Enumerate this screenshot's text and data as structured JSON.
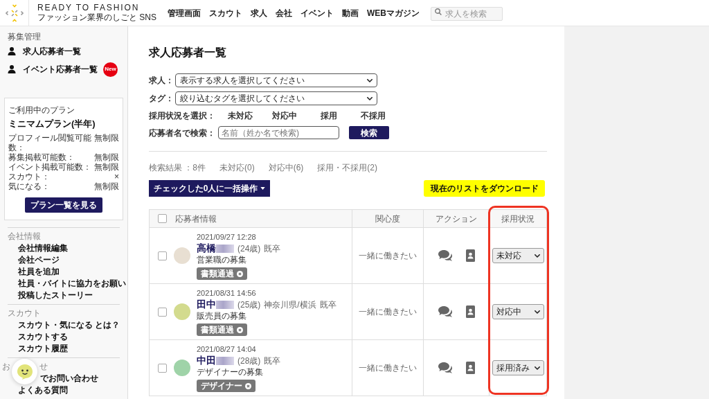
{
  "header": {
    "logo_title": "READY TO FASHION",
    "logo_subtitle": "ファッション業界のしごと SNS",
    "nav": [
      "管理画面",
      "スカウト",
      "求人",
      "会社",
      "イベント",
      "動画",
      "WEBマガジン"
    ],
    "search": {
      "placeholder": "求人を検索"
    }
  },
  "sidebar": {
    "recruit": {
      "heading": "募集管理",
      "items": [
        {
          "label": "求人応募者一覧"
        },
        {
          "label": "イベント応募者一覧",
          "badge": "New"
        }
      ]
    },
    "plan": {
      "caption": "ご利用中のプラン",
      "name": "ミニマムプラン(半年)",
      "rows": [
        {
          "label": "プロフィール閲覧可能数：",
          "value": "無制限"
        },
        {
          "label": "募集掲載可能数：",
          "value": "無制限"
        },
        {
          "label": "イベント掲載可能数：",
          "value": "無制限"
        },
        {
          "label": "スカウト：",
          "value": "×"
        },
        {
          "label": "気になる：",
          "value": "無制限"
        }
      ],
      "button": "プラン一覧を見る"
    },
    "sections": [
      {
        "heading": "会社情報",
        "items": [
          "会社情報編集",
          "会社ページ",
          "社員を追加",
          "社員・バイトに協力をお願い",
          "投稿したストーリー"
        ]
      },
      {
        "heading": "スカウト",
        "items": [
          "スカウト・気になる とは？",
          "スカウトする",
          "スカウト履歴"
        ]
      }
    ],
    "contact": {
      "heading_parts": [
        "お",
        "せ"
      ],
      "items": [
        "でお問い合わせ",
        "よくある質問"
      ]
    }
  },
  "main": {
    "title": "求人応募者一覧",
    "job_filter": {
      "label": "求人：",
      "value": "表示する求人を選択してください"
    },
    "tag_filter": {
      "label": "タグ：",
      "value": "絞り込むタグを選択してください"
    },
    "status_filter": {
      "label": "採用状況を選択：",
      "options": [
        "未対応",
        "対応中",
        "採用",
        "不採用"
      ]
    },
    "name_search": {
      "label": "応募者名で検索：",
      "placeholder": "名前（姓か名で検索)",
      "button": "検索"
    },
    "results": {
      "count": "検索結果 ：8件",
      "filters": [
        "未対応(0)",
        "対応中(6)",
        "採用・不採用(2)"
      ]
    },
    "actions": {
      "bulk": "チェックした0人に一括操作",
      "download": "現在のリストをダウンロード"
    },
    "table": {
      "select_all": {
        "checked": false
      },
      "columns": [
        {
          "label": "応募者情報",
          "highlighted": false
        },
        {
          "label": "関心度",
          "highlighted": false
        },
        {
          "label": "アクション",
          "highlighted": false
        },
        {
          "label": "採用状況",
          "highlighted": true
        }
      ],
      "rows": [
        {
          "checked": false,
          "date": "2021/09/27 12:28",
          "name": "高橋",
          "age": "(24歳)",
          "graduation": "既卒",
          "job": "営業職の募集",
          "tags": [
            "書類通過"
          ],
          "interest": "一緒に働きたい",
          "status": "未対応"
        },
        {
          "checked": false,
          "date": "2021/08/31 14:56",
          "name": "田中",
          "age": "(25歳)",
          "location": "神奈川県/横浜",
          "graduation": "既卒",
          "job": "販売員の募集",
          "tags": [
            "書類通過"
          ],
          "interest": "一緒に働きたい",
          "status": "対応中"
        },
        {
          "checked": false,
          "date": "2021/08/27 14:04",
          "name": "中田",
          "age": "(28歳)",
          "graduation": "既卒",
          "job": "デザイナーの募集",
          "tags": [
            "デザイナー"
          ],
          "interest": "一緒に働きたい",
          "status": "採用済み"
        }
      ]
    }
  }
}
